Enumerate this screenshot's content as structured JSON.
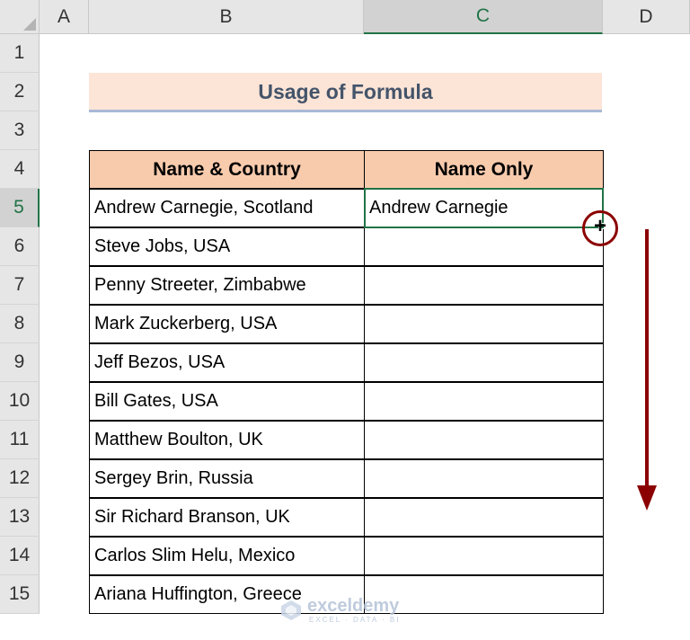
{
  "columns": [
    "A",
    "B",
    "C",
    "D"
  ],
  "active_column": "C",
  "rows": [
    "1",
    "2",
    "3",
    "4",
    "5",
    "6",
    "7",
    "8",
    "9",
    "10",
    "11",
    "12",
    "13",
    "14",
    "15"
  ],
  "active_row": "5",
  "title": "Usage of Formula",
  "table": {
    "headers": [
      "Name & Country",
      "Name Only"
    ],
    "rows": [
      [
        "Andrew Carnegie, Scotland",
        "Andrew Carnegie"
      ],
      [
        "Steve Jobs, USA",
        ""
      ],
      [
        "Penny Streeter, Zimbabwe",
        ""
      ],
      [
        "Mark Zuckerberg, USA",
        ""
      ],
      [
        "Jeff Bezos, USA",
        ""
      ],
      [
        "Bill Gates, USA",
        ""
      ],
      [
        "Matthew Boulton, UK",
        ""
      ],
      [
        "Sergey Brin, Russia",
        ""
      ],
      [
        "Sir Richard Branson, UK",
        ""
      ],
      [
        "Carlos Slim Helu, Mexico",
        ""
      ],
      [
        "Ariana Huffington, Greece",
        ""
      ]
    ]
  },
  "cursor_symbol": "+",
  "watermark": {
    "name": "exceldemy",
    "tagline": "EXCEL · DATA · BI"
  },
  "colors": {
    "accent_green": "#217346",
    "header_fill": "#f8cbad",
    "title_fill": "#fce4d6",
    "arrow": "#8b0000"
  }
}
